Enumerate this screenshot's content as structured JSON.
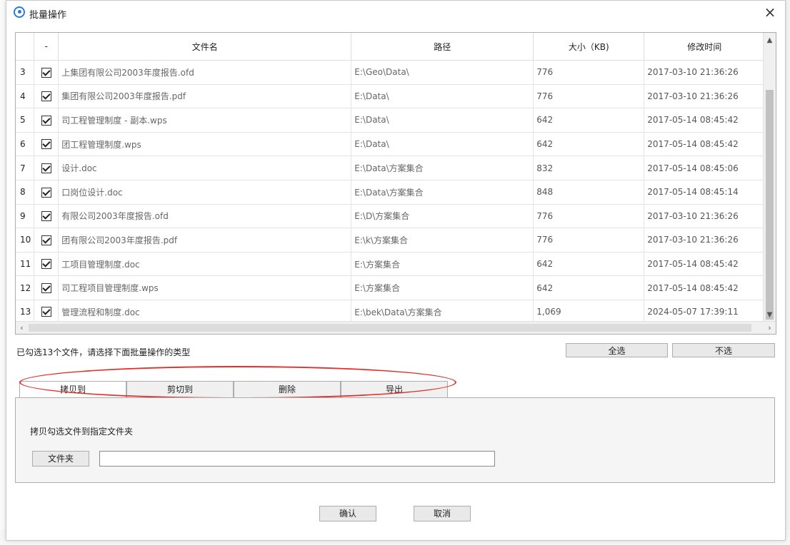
{
  "window": {
    "title": "批量操作",
    "close_glyph": "×"
  },
  "table": {
    "columns": {
      "index": "",
      "check": "-",
      "name": "文件名",
      "path": "路径",
      "size": "大小（KB)",
      "modified": "修改时间"
    },
    "rows": [
      {
        "index": "3",
        "name": "上集团有限公司2003年度报告.ofd",
        "path": "E:\\Geo\\Data\\",
        "size": "776",
        "modified": "2017-03-10 21:36:26"
      },
      {
        "index": "4",
        "name": "集团有限公司2003年度报告.pdf",
        "path": "E:\\Data\\",
        "size": "776",
        "modified": "2017-03-10 21:36:26"
      },
      {
        "index": "5",
        "name": "司工程管理制度 - 副本.wps",
        "path": "E:\\Data\\",
        "size": "642",
        "modified": "2017-05-14 08:45:42"
      },
      {
        "index": "6",
        "name": "团工程管理制度.wps",
        "path": "E:\\Data\\",
        "size": "642",
        "modified": "2017-05-14 08:45:42"
      },
      {
        "index": "7",
        "name": "设计.doc",
        "path": "E:\\Data\\方案集合",
        "size": "832",
        "modified": "2017-05-14 08:45:06"
      },
      {
        "index": "8",
        "name": "口岗位设计.doc",
        "path": "E:\\Data\\方案集合",
        "size": "848",
        "modified": "2017-05-14 08:45:14"
      },
      {
        "index": "9",
        "name": "有限公司2003年度报告.ofd",
        "path": "E:\\D\\方案集合",
        "size": "776",
        "modified": "2017-03-10 21:36:26"
      },
      {
        "index": "10",
        "name": "团有限公司2003年度报告.pdf",
        "path": "E:\\k\\方案集合",
        "size": "776",
        "modified": "2017-03-10 21:36:26"
      },
      {
        "index": "11",
        "name": "工项目管理制度.doc",
        "path": "E:\\方案集合",
        "size": "642",
        "modified": "2017-05-14 08:45:42"
      },
      {
        "index": "12",
        "name": "司工程项目管理制度.wps",
        "path": "E:\\方案集合",
        "size": "642",
        "modified": "2017-05-14 08:45:42"
      },
      {
        "index": "13",
        "name": "管理流程和制度.doc",
        "path": "E:\\bek\\Data\\方案集合",
        "size": "1,069",
        "modified": "2024-05-07 17:39:11"
      }
    ]
  },
  "status_text": "已勾选13个文件，请选择下面批量操作的类型",
  "buttons": {
    "select_all": "全选",
    "select_none": "不选",
    "confirm": "确认",
    "cancel": "取消",
    "folder": "文件夹"
  },
  "tabs": [
    {
      "label": "拷贝到",
      "active": true
    },
    {
      "label": "剪切到",
      "active": false
    },
    {
      "label": "删除",
      "active": false
    },
    {
      "label": "导出",
      "active": false
    }
  ],
  "panel": {
    "description": "拷贝勾选文件到指定文件夹",
    "folder_path": ""
  },
  "colors": {
    "highlight_ellipse": "#e0302a",
    "accent": "#2b7bd6"
  }
}
